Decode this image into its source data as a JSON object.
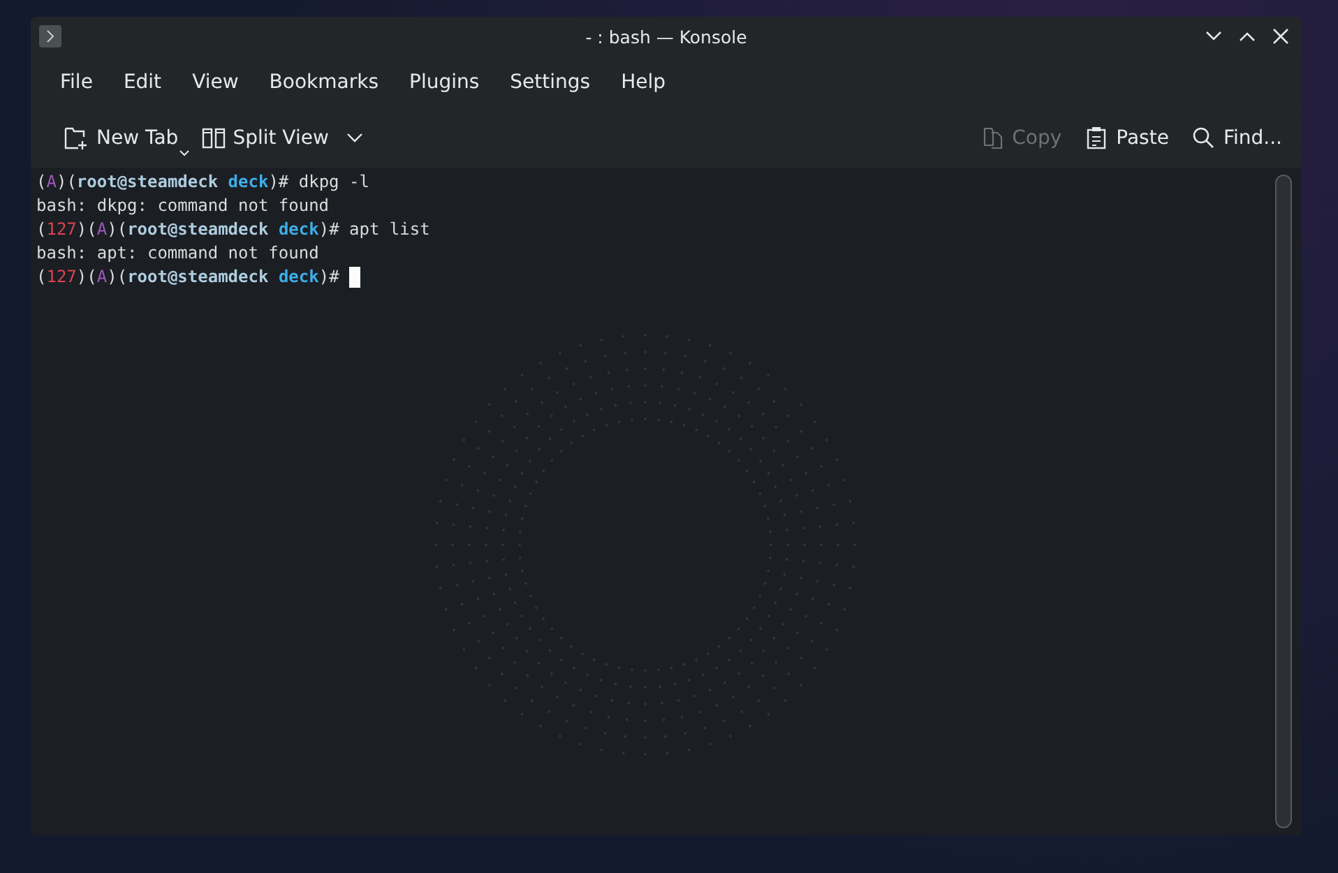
{
  "window": {
    "title": "- : bash — Konsole"
  },
  "menu": [
    "File",
    "Edit",
    "View",
    "Bookmarks",
    "Plugins",
    "Settings",
    "Help"
  ],
  "toolbar_left": [
    {
      "kind": "new-tab",
      "label": "New Tab",
      "disabled": false
    },
    {
      "kind": "split-view",
      "label": "Split View",
      "disabled": false
    }
  ],
  "toolbar_right": [
    {
      "kind": "copy",
      "label": "Copy",
      "disabled": true
    },
    {
      "kind": "paste",
      "label": "Paste",
      "disabled": false
    },
    {
      "kind": "find",
      "label": "Find...",
      "disabled": false
    }
  ],
  "terminal": {
    "lines": [
      [
        {
          "kind": "plain",
          "text": "("
        },
        {
          "kind": "mode",
          "text": "A"
        },
        {
          "kind": "plain",
          "text": ")("
        },
        {
          "kind": "user",
          "text": "root@steamdeck "
        },
        {
          "kind": "dir",
          "text": "deck"
        },
        {
          "kind": "plain",
          "text": ")# dkpg -l"
        }
      ],
      [
        {
          "kind": "plain",
          "text": "bash: dkpg: command not found"
        }
      ],
      [
        {
          "kind": "plain",
          "text": "("
        },
        {
          "kind": "code",
          "text": "127"
        },
        {
          "kind": "plain",
          "text": ")("
        },
        {
          "kind": "mode",
          "text": "A"
        },
        {
          "kind": "plain",
          "text": ")("
        },
        {
          "kind": "user",
          "text": "root@steamdeck "
        },
        {
          "kind": "dir",
          "text": "deck"
        },
        {
          "kind": "plain",
          "text": ")# apt list"
        }
      ],
      [
        {
          "kind": "plain",
          "text": "bash: apt: command not found"
        }
      ],
      [
        {
          "kind": "plain",
          "text": "("
        },
        {
          "kind": "code",
          "text": "127"
        },
        {
          "kind": "plain",
          "text": ")("
        },
        {
          "kind": "mode",
          "text": "A"
        },
        {
          "kind": "plain",
          "text": ")("
        },
        {
          "kind": "user",
          "text": "root@steamdeck "
        },
        {
          "kind": "dir",
          "text": "deck"
        },
        {
          "kind": "plain",
          "text": ")#"
        }
      ]
    ],
    "cursor": true
  }
}
